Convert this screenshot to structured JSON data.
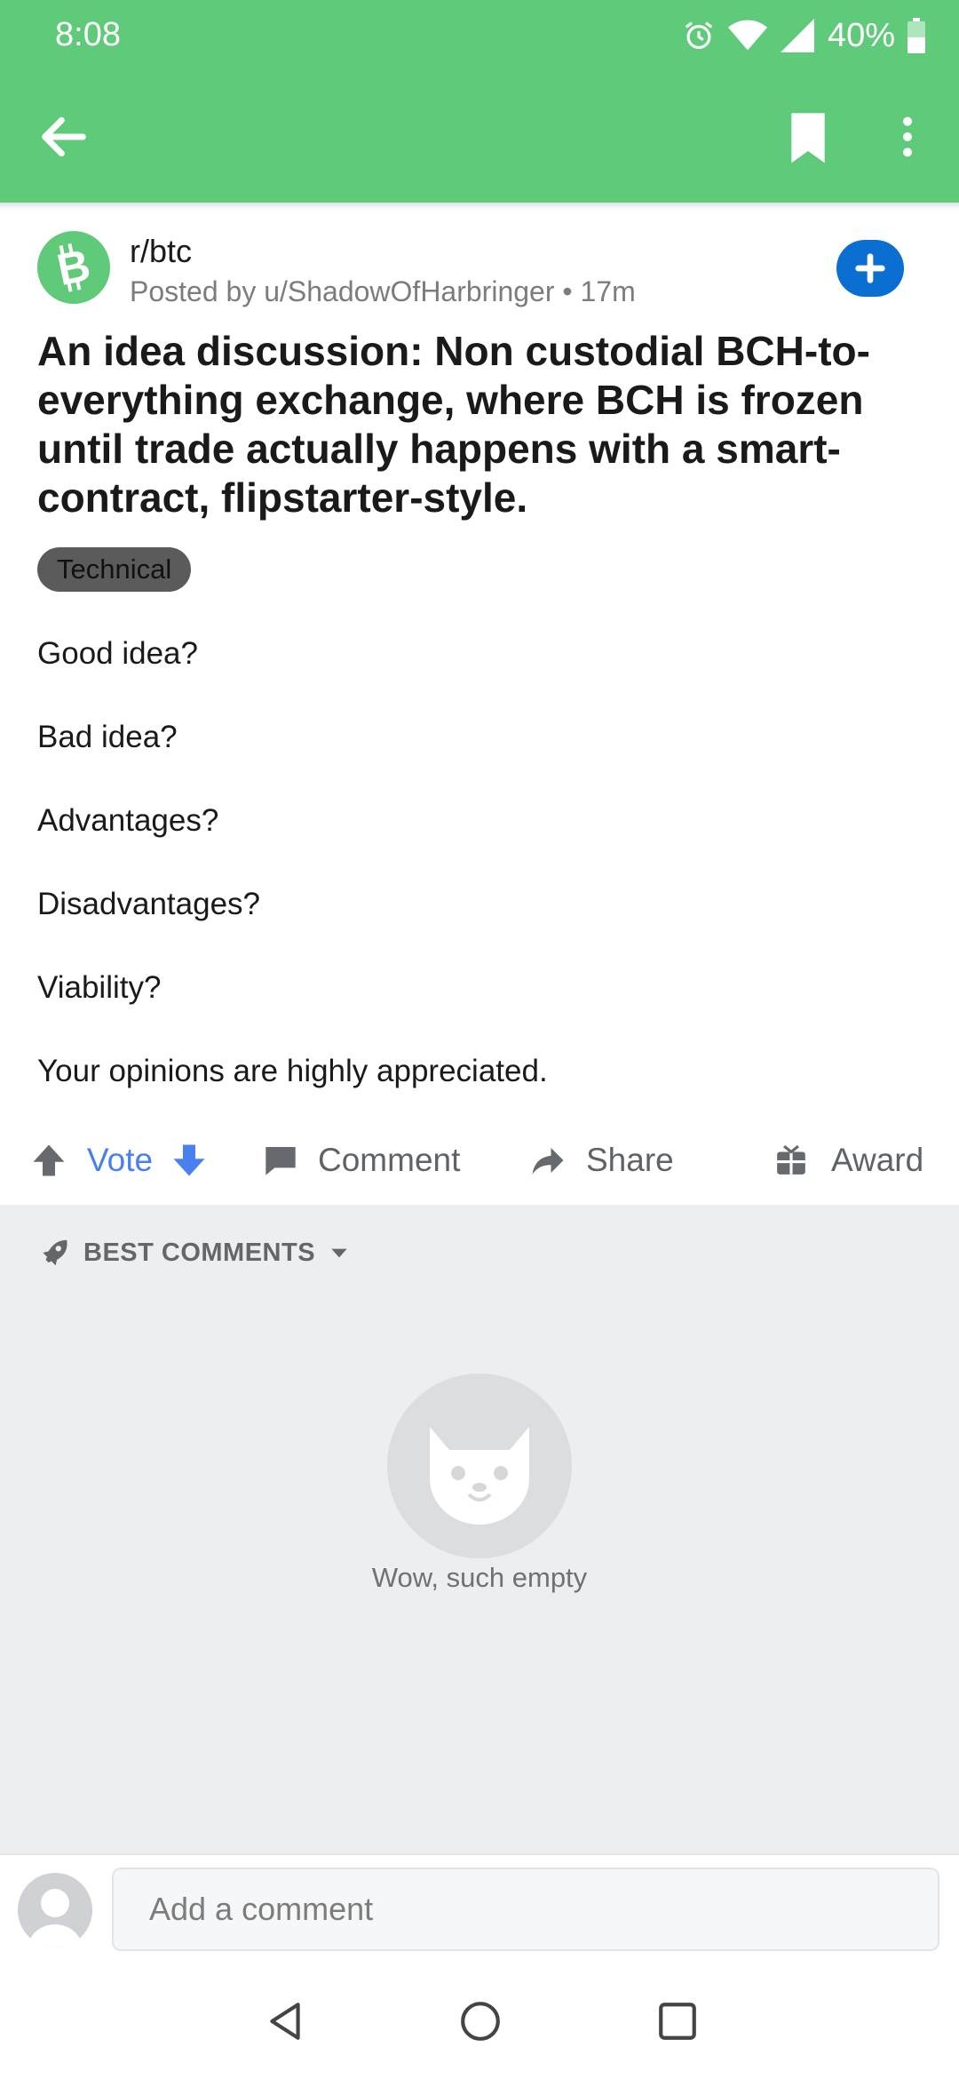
{
  "status_bar": {
    "time": "8:08",
    "battery": "40%",
    "icons": [
      "alarm-icon",
      "wifi-icon",
      "signal-icon",
      "battery-icon"
    ]
  },
  "app_bar": {
    "icons": [
      "back-arrow-icon",
      "bookmark-icon",
      "more-vert-icon"
    ]
  },
  "post": {
    "subreddit": "r/btc",
    "posted_by": "Posted by u/ShadowOfHarbringer • 17m",
    "title": "An idea discussion: Non custodial BCH-to-everything exchange, where BCH is frozen until trade actually happens with a smart-contract, flipstarter-style.",
    "flair": "Technical",
    "body": [
      "Good idea?",
      "Bad idea?",
      "Advantages?",
      "Disadvantages?",
      "Viability?",
      "Your opinions are highly appreciated."
    ]
  },
  "actions": {
    "vote": "Vote",
    "comment": "Comment",
    "share": "Share",
    "award": "Award"
  },
  "comments": {
    "sort_label": "BEST COMMENTS",
    "empty_text": "Wow, such empty"
  },
  "composer": {
    "placeholder": "Add a comment"
  },
  "colors": {
    "brand_green": "#5fcb7a",
    "upvote_blue": "#4a7ff0",
    "join_blue": "#0a6fd1"
  }
}
